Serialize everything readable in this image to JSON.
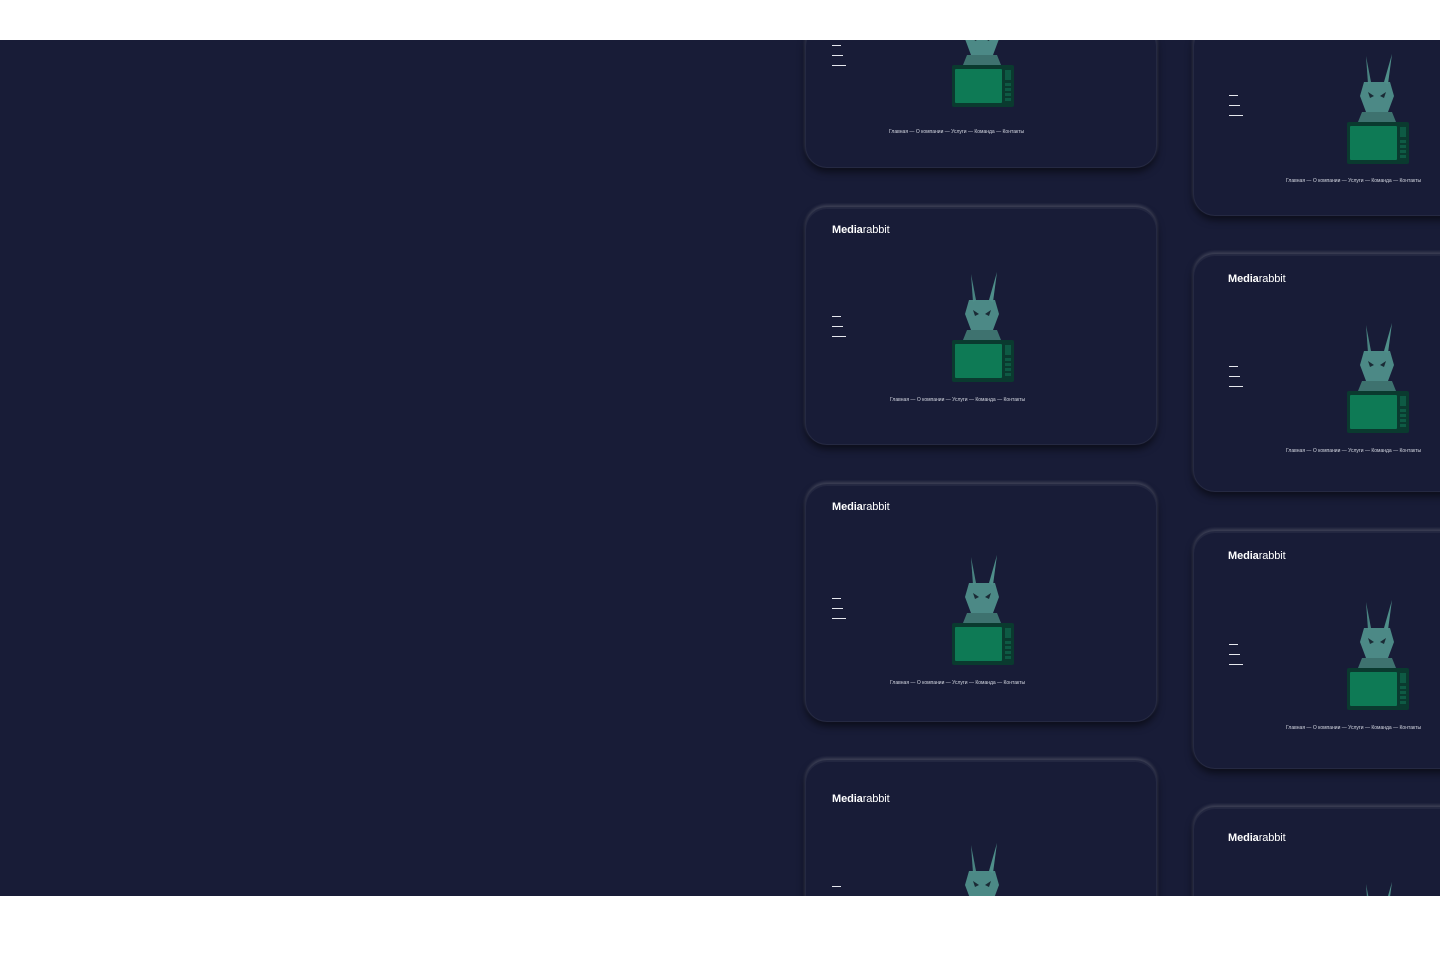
{
  "brand": {
    "logo_bold": "Media",
    "logo_light": "rabbit"
  },
  "nav": {
    "items": [
      "Главная",
      "О компании",
      "Услуги",
      "Команда",
      "Контакты"
    ],
    "separator": "—"
  },
  "icons": {
    "menu": "hamburger-menu-icon",
    "mascot": "rabbit-on-tv-illustration"
  },
  "colors": {
    "background": "#181c37",
    "tv_screen": "#0e7a55",
    "rabbit": "#4f8f8a",
    "text": "#ffffff"
  }
}
